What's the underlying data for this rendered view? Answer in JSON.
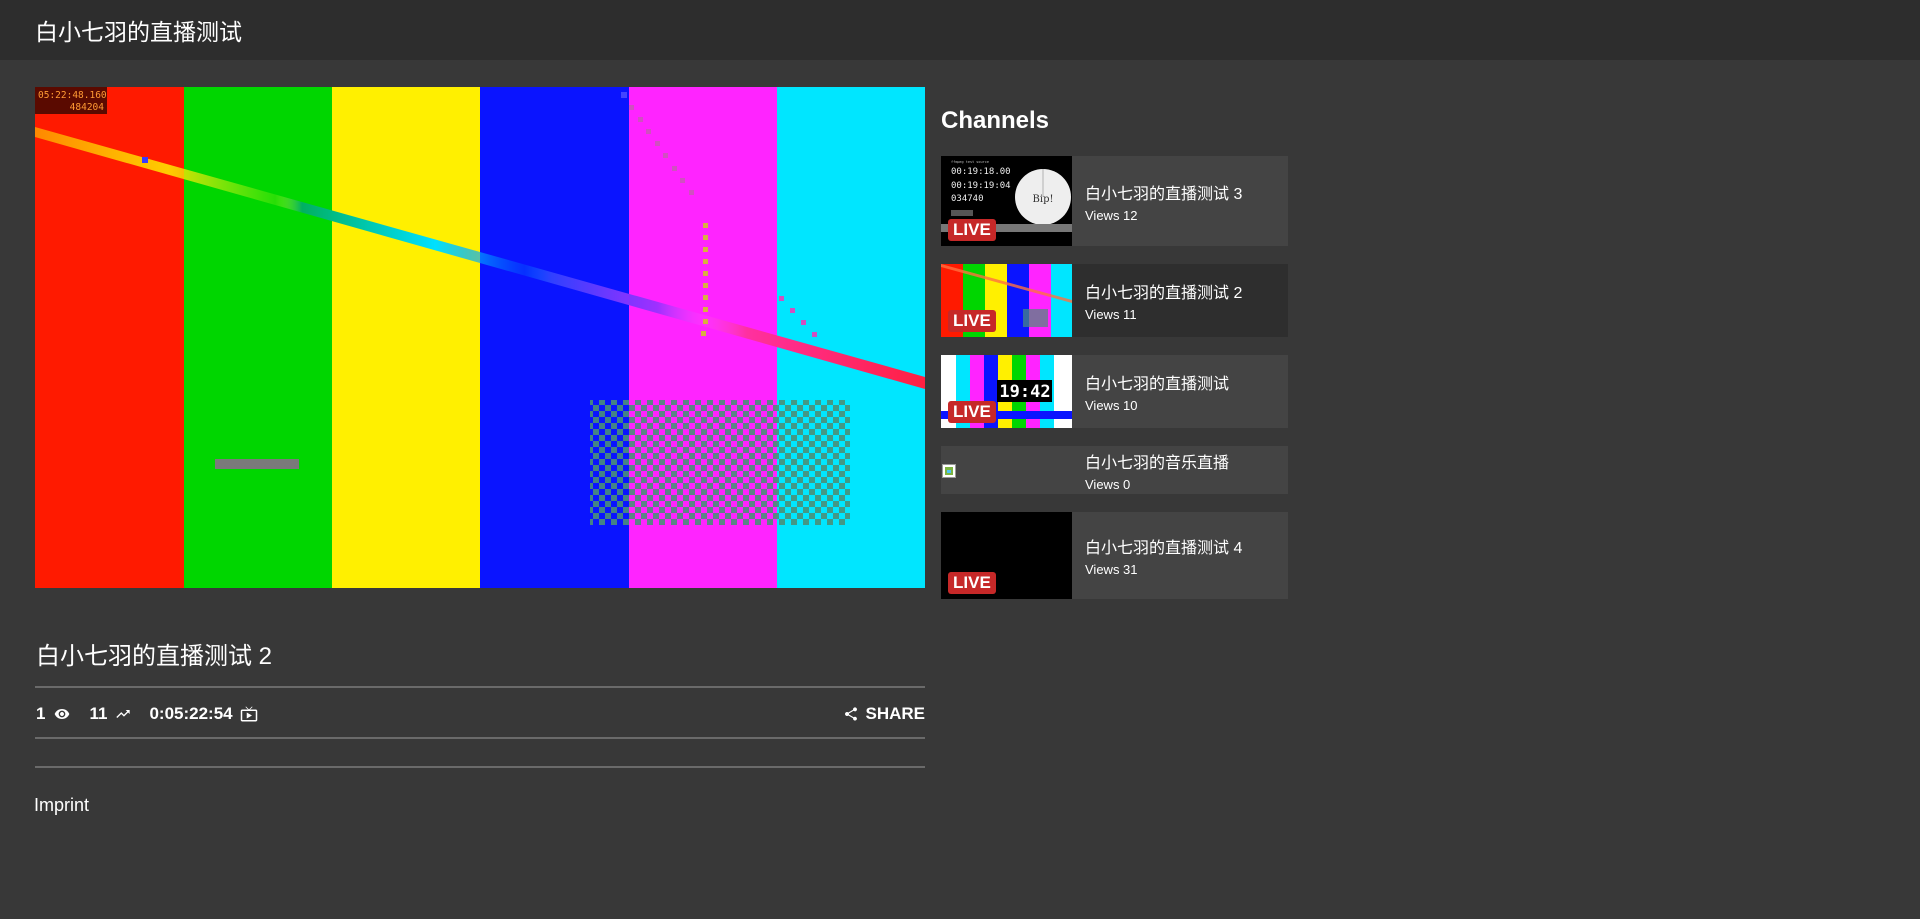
{
  "header": {
    "title": "白小七羽的直播测试"
  },
  "player": {
    "timecode": "05:22:48.160",
    "frame": "484204"
  },
  "stream": {
    "title": "白小七羽的直播测试 2",
    "viewers": "1",
    "views": "11",
    "uptime": "0:05:22:54",
    "share_label": "SHARE"
  },
  "footer": {
    "imprint": "Imprint"
  },
  "sidebar": {
    "heading": "Channels",
    "channels": [
      {
        "title": "白小七羽的直播测试 3",
        "views": "Views 12",
        "live": "LIVE",
        "thumb_time1": "00:19:18.00",
        "thumb_time2": "00:19:19:04",
        "thumb_frame": "034740",
        "thumb_bip": "Bip!"
      },
      {
        "title": "白小七羽的直播测试 2",
        "views": "Views 11",
        "live": "LIVE"
      },
      {
        "title": "白小七羽的直播测试",
        "views": "Views 10",
        "live": "LIVE",
        "thumb_clock": "19:42"
      },
      {
        "title": "白小七羽的音乐直播",
        "views": "Views 0"
      },
      {
        "title": "白小七羽的直播测试 4",
        "views": "Views 31",
        "live": "LIVE"
      }
    ]
  },
  "colors": {
    "bar_red": "#ff1a00",
    "bar_green": "#00d600",
    "bar_yellow": "#fff000",
    "bar_blue": "#0a14ff",
    "bar_magenta": "#ff24ff",
    "bar_cyan": "#00e6ff",
    "live_red": "#c62828"
  },
  "icons": {
    "viewers": "eye-icon",
    "views": "trending-up-icon",
    "uptime": "live-tv-icon",
    "share": "share-icon"
  }
}
